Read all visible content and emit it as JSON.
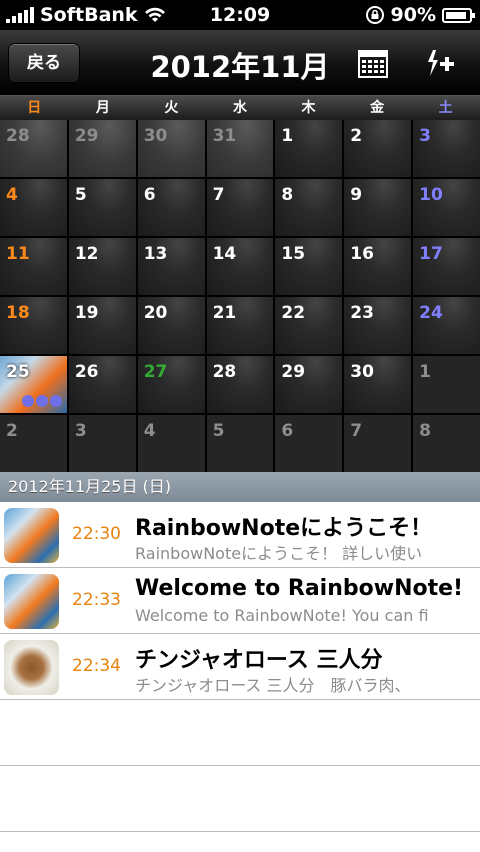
{
  "status_bar": {
    "carrier": "SoftBank",
    "time": "12:09",
    "battery": "90%",
    "battery_level": 0.9
  },
  "nav": {
    "back_label": "戻る",
    "title": "2012年11月",
    "calendar_icon": "calendar-grid-icon",
    "add_icon": "add-event-icon"
  },
  "weekdays": [
    "日",
    "月",
    "火",
    "水",
    "木",
    "金",
    "土"
  ],
  "calendar": {
    "weeks": [
      [
        "28",
        "29",
        "30",
        "31",
        "1",
        "2",
        "3"
      ],
      [
        "4",
        "5",
        "6",
        "7",
        "8",
        "9",
        "10"
      ],
      [
        "11",
        "12",
        "13",
        "14",
        "15",
        "16",
        "17"
      ],
      [
        "18",
        "19",
        "20",
        "21",
        "22",
        "23",
        "24"
      ],
      [
        "25",
        "26",
        "27",
        "28",
        "29",
        "30",
        "1"
      ],
      [
        "2",
        "3",
        "4",
        "5",
        "6",
        "7",
        "8"
      ]
    ],
    "selected_date": "25",
    "today_date": "27"
  },
  "section": {
    "date_header": "2012年11月25日 (日)"
  },
  "entries": [
    {
      "time": "22:30",
      "title": "RainbowNoteにようこそ！",
      "preview": "RainbowNoteにようこそ！ 詳しい使い",
      "thumb": "game-screenshot"
    },
    {
      "time": "22:33",
      "title": "Welcome to RainbowNote!",
      "preview": "Welcome to RainbowNote!  You can fi",
      "thumb": "game-screenshot"
    },
    {
      "time": "22:34",
      "title": "チンジャオロース 三人分",
      "preview": "チンジャオロース 三人分　豚バラ肉、",
      "thumb": "food-photo"
    }
  ],
  "colors": {
    "sunday": "#ff8a1a",
    "saturday": "#8080ff",
    "today": "#33aa33",
    "entry_time": "#e8820e"
  }
}
